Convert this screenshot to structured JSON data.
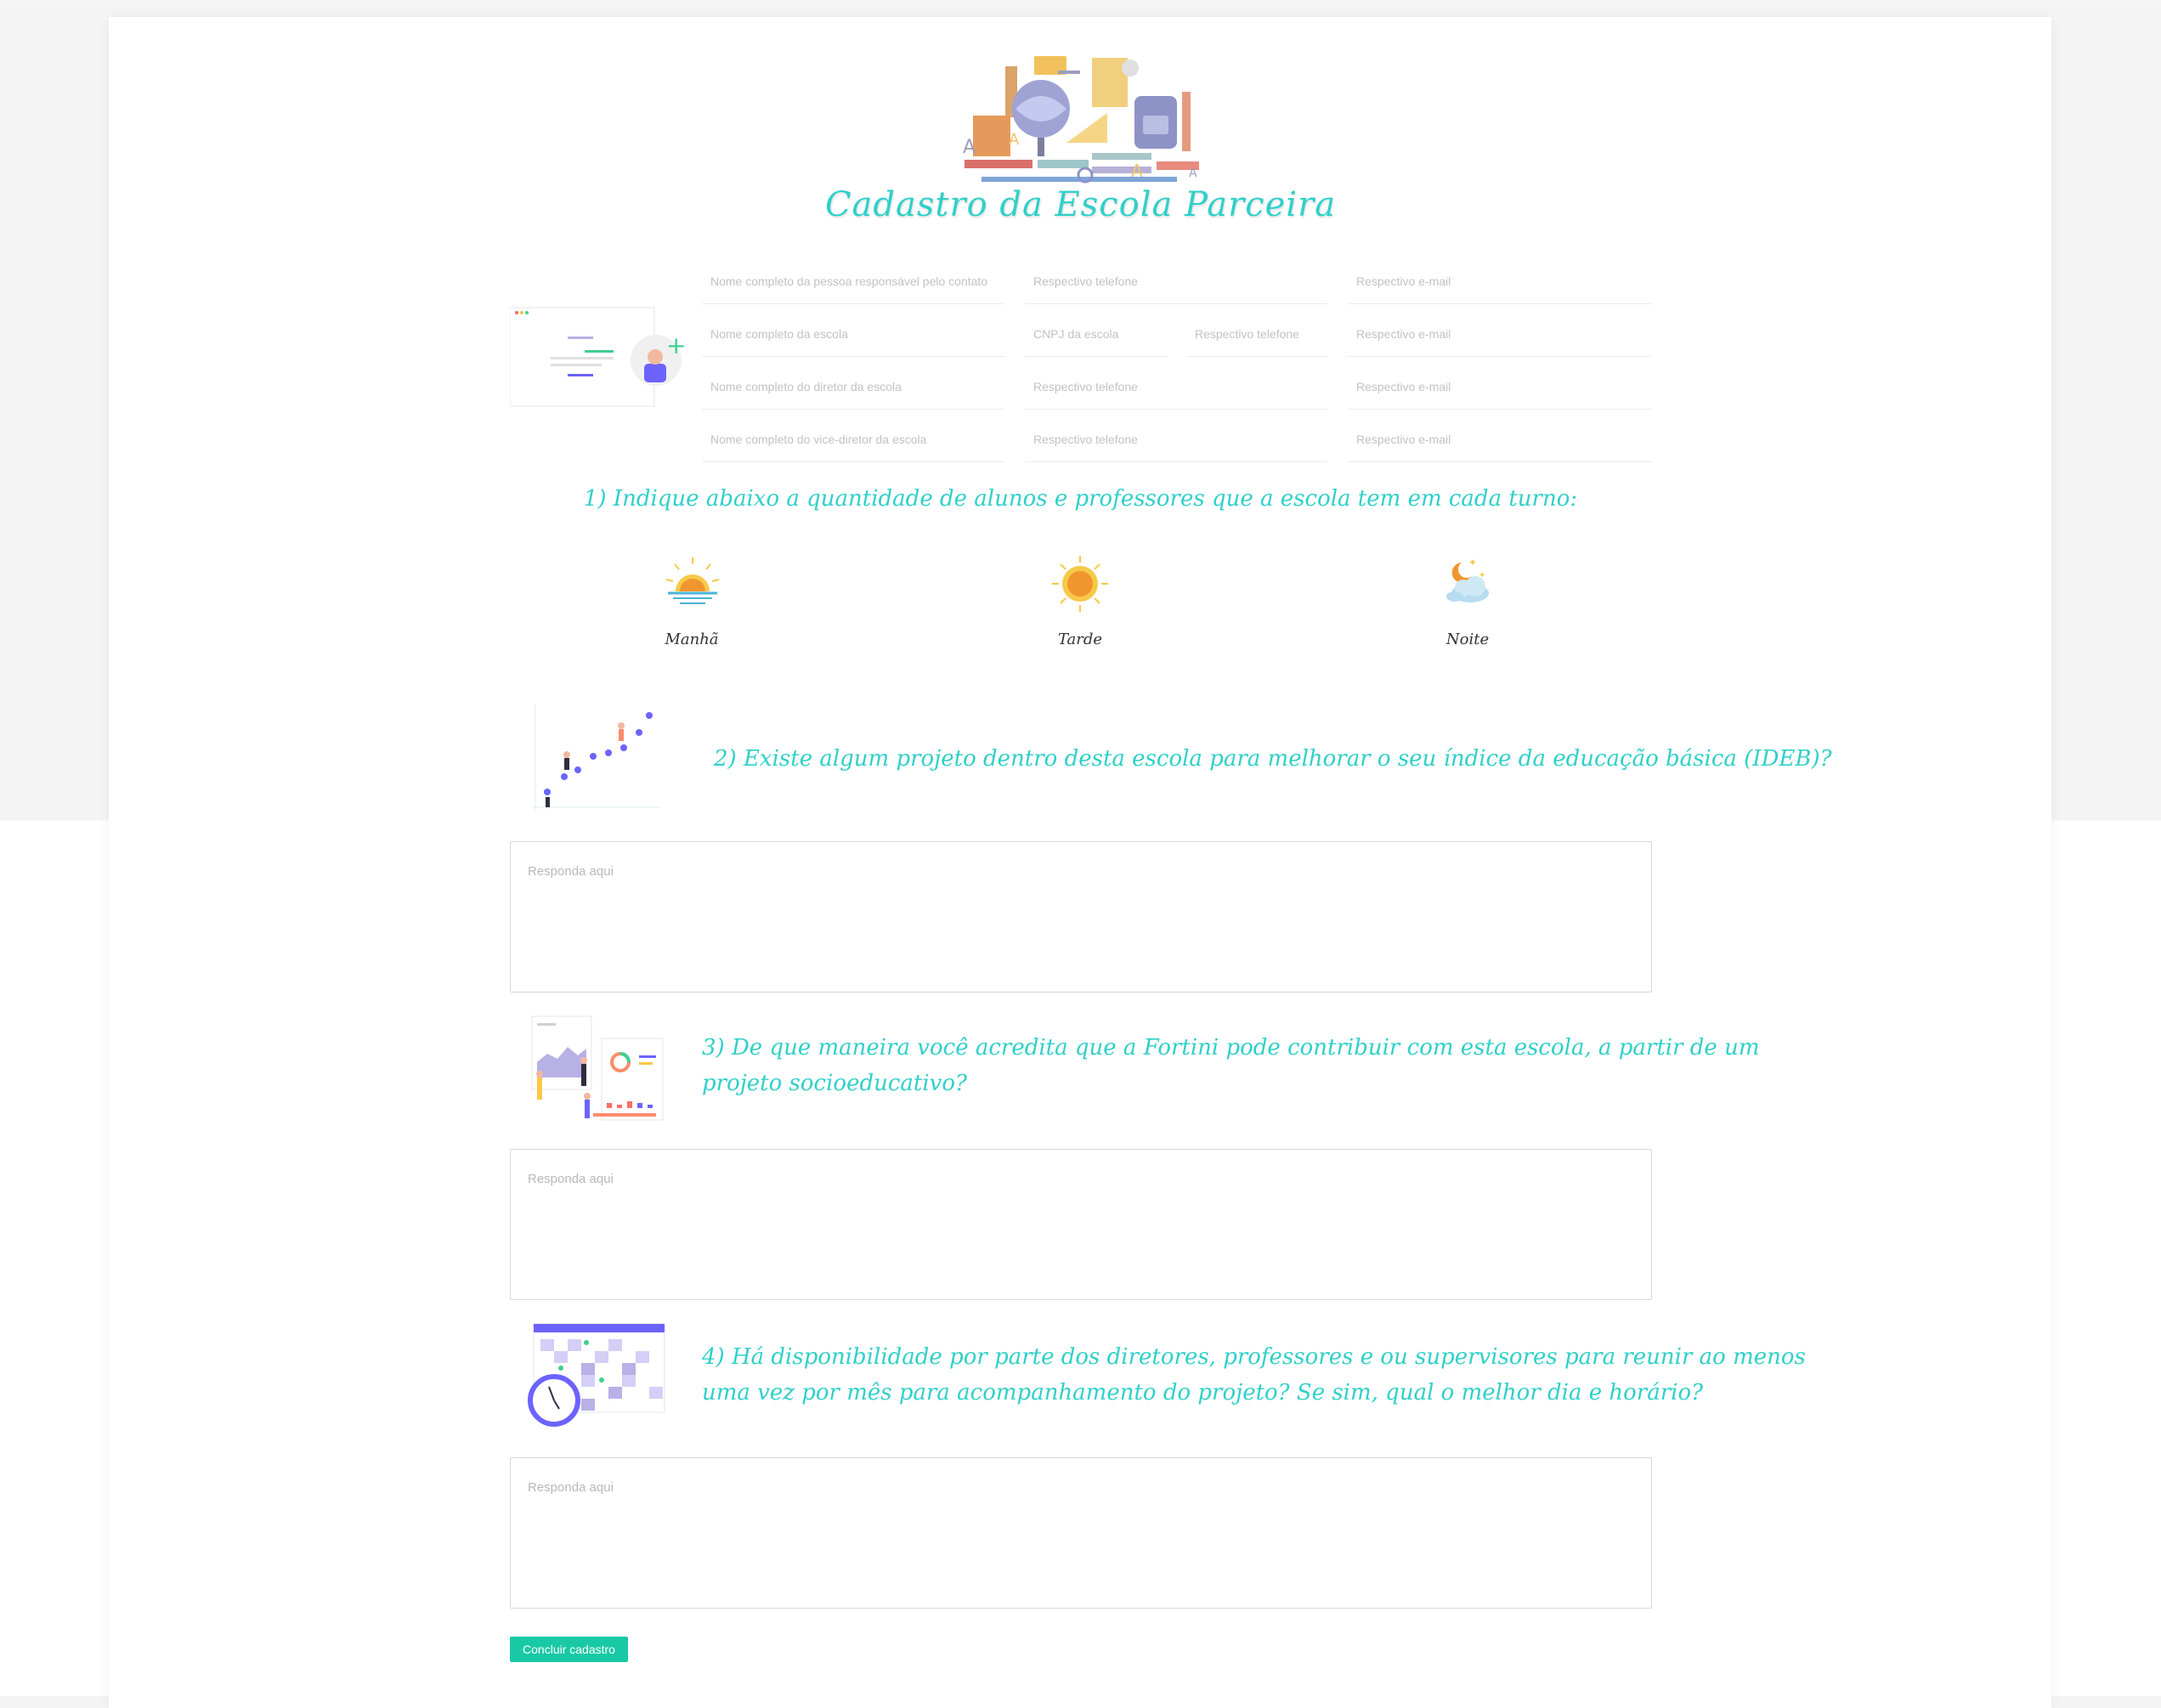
{
  "page": {
    "title": "Cadastro da Escola Parceira"
  },
  "contacts": {
    "row1": {
      "name": "Nome completo da pessoa responsável pelo contato",
      "phone": "Respectivo telefone",
      "email": "Respectivo e-mail"
    },
    "row2": {
      "name": "Nome completo da escola",
      "cnpj": "CNPJ da escola",
      "phone": "Respectivo telefone",
      "email": "Respectivo e-mail"
    },
    "row3": {
      "name": "Nome completo do diretor da escola",
      "phone": "Respectivo telefone",
      "email": "Respectivo e-mail"
    },
    "row4": {
      "name": "Nome completo do vice-diretor da escola",
      "phone": "Respectivo telefone",
      "email": "Respectivo e-mail"
    }
  },
  "q1": {
    "text": "1) Indique abaixo a quantidade de alunos e professores que a escola tem em cada turno:",
    "turns": [
      "Manhã",
      "Tarde",
      "Noite"
    ]
  },
  "q2": {
    "text": "2) Existe algum projeto dentro desta escola para melhorar o seu índice da educação básica (IDEB)?",
    "placeholder": "Responda aqui"
  },
  "q3": {
    "line1": "3) De que maneira você acredita que a Fortini pode contribuir com esta escola, a partir de um",
    "line2": "projeto socioeducativo?",
    "placeholder": "Responda aqui"
  },
  "q4": {
    "line1": "4) Há disponibilidade por parte dos diretores, professores e ou supervisores para reunir ao menos",
    "line2": "uma vez por mês para acompanhamento do projeto? Se sim, qual o melhor dia e horário?",
    "placeholder": "Responda aqui"
  },
  "submit": {
    "label": "Concluir cadastro"
  },
  "colors": {
    "accent": "#2fd0c9",
    "button": "#19c9a5"
  }
}
